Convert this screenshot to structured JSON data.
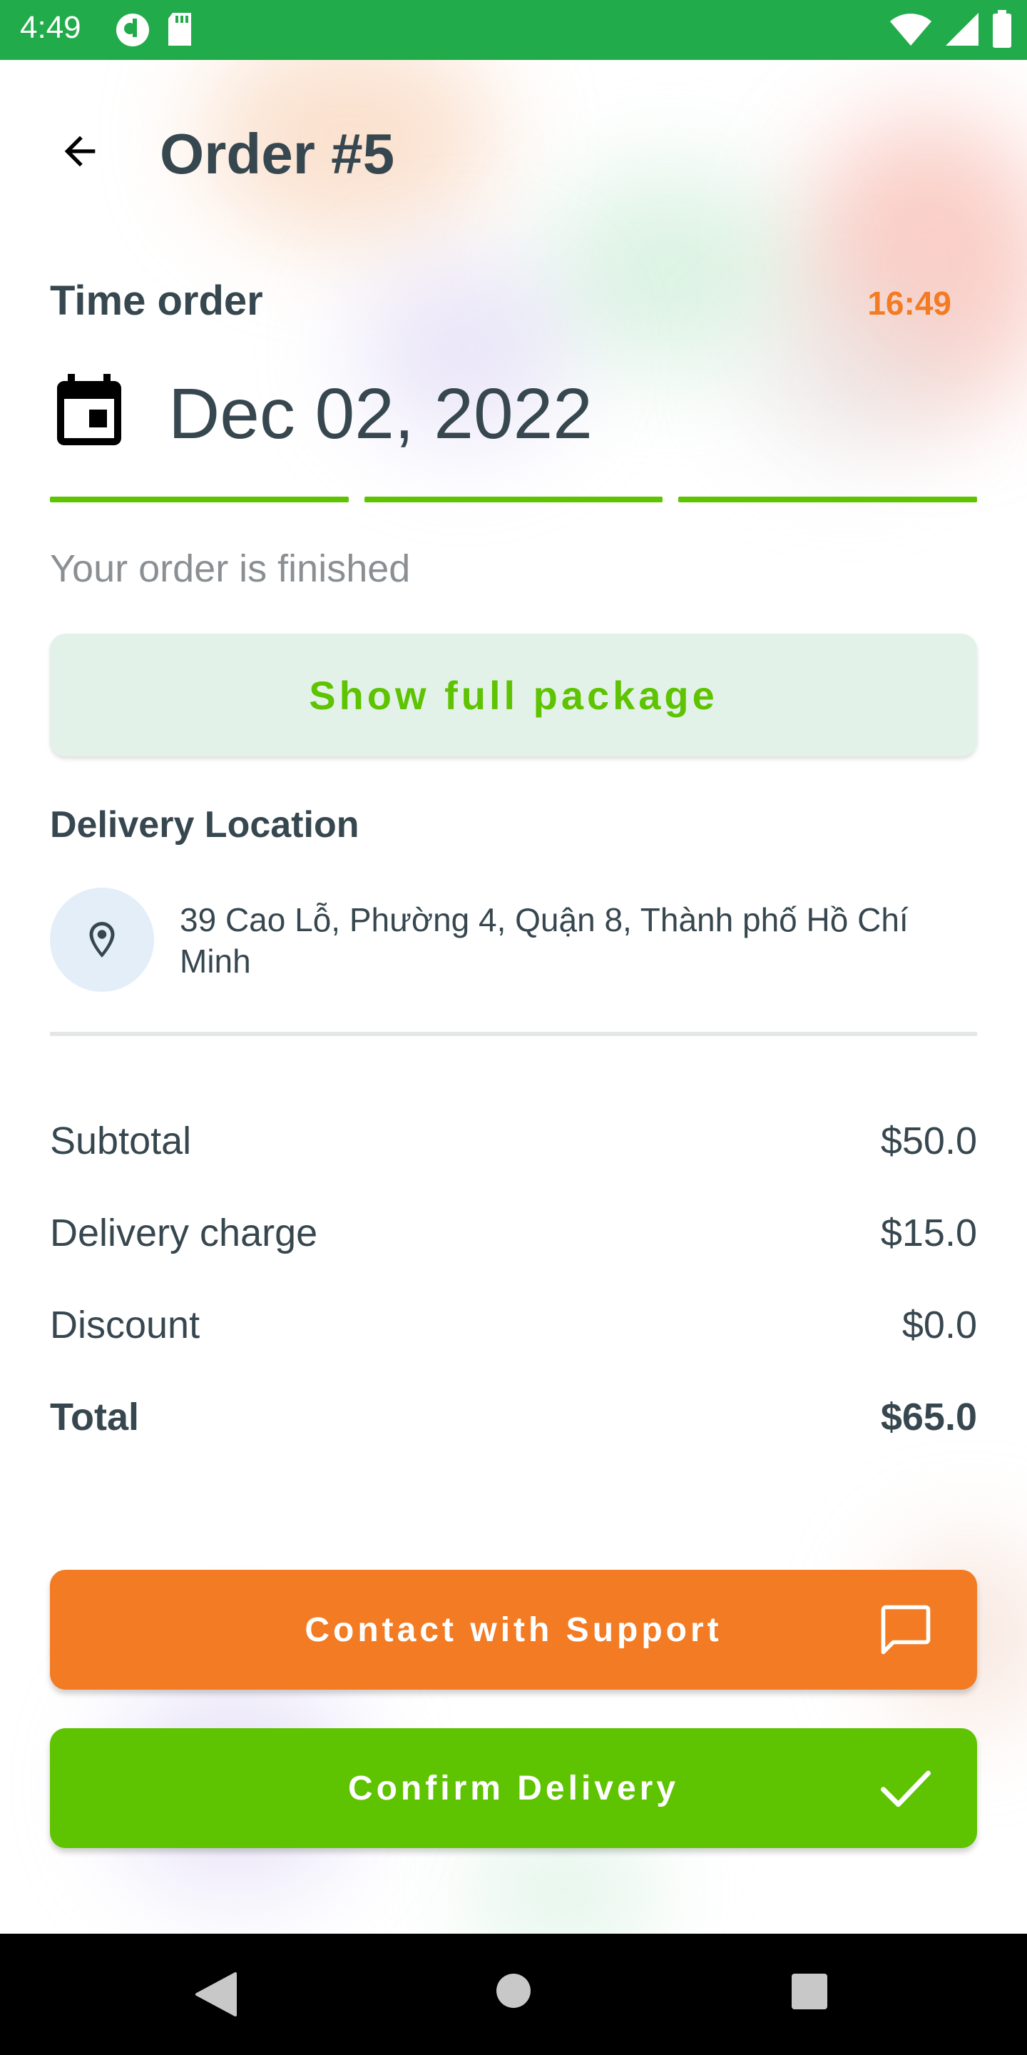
{
  "status_bar": {
    "time": "4:49",
    "icons": [
      "notification-app-icon",
      "sd-card-icon",
      "wifi-icon",
      "signal-icon",
      "battery-icon"
    ]
  },
  "header": {
    "back_icon": "arrow-back-icon",
    "title": "Order #5"
  },
  "time_order": {
    "label": "Time order",
    "time": "16:49",
    "calendar_icon": "calendar-icon",
    "date": "Dec 02, 2022"
  },
  "progress": {
    "segments_total": 3,
    "segments_completed": 3
  },
  "order_status": "Your order is finished",
  "show_package": {
    "label": "Show full package"
  },
  "delivery": {
    "heading": "Delivery Location",
    "pin_icon": "location-pin-icon",
    "address": "39 Cao Lỗ, Phường 4, Quận 8, Thành phố Hồ Chí Minh"
  },
  "summary": {
    "subtotal": {
      "label": "Subtotal",
      "value": "$50.0"
    },
    "delivery_charge": {
      "label": "Delivery charge",
      "value": "$15.0"
    },
    "discount": {
      "label": "Discount",
      "value": "$0.0"
    },
    "total": {
      "label": "Total",
      "value": "$65.0"
    }
  },
  "actions": {
    "contact": {
      "label": "Contact with Support",
      "icon": "chat-icon"
    },
    "confirm": {
      "label": "Confirm Delivery",
      "icon": "check-icon"
    }
  },
  "colors": {
    "status_bar": "#22ab4a",
    "accent_green": "#5ec300",
    "accent_orange": "#f27b24",
    "text_primary": "#37474f",
    "text_muted": "#8a8f93",
    "package_button_bg": "#e3f2e9",
    "pin_circle_bg": "#e3eef9"
  },
  "nav_bar": {
    "icons": [
      "nav-back-icon",
      "nav-home-icon",
      "nav-recents-icon"
    ]
  }
}
